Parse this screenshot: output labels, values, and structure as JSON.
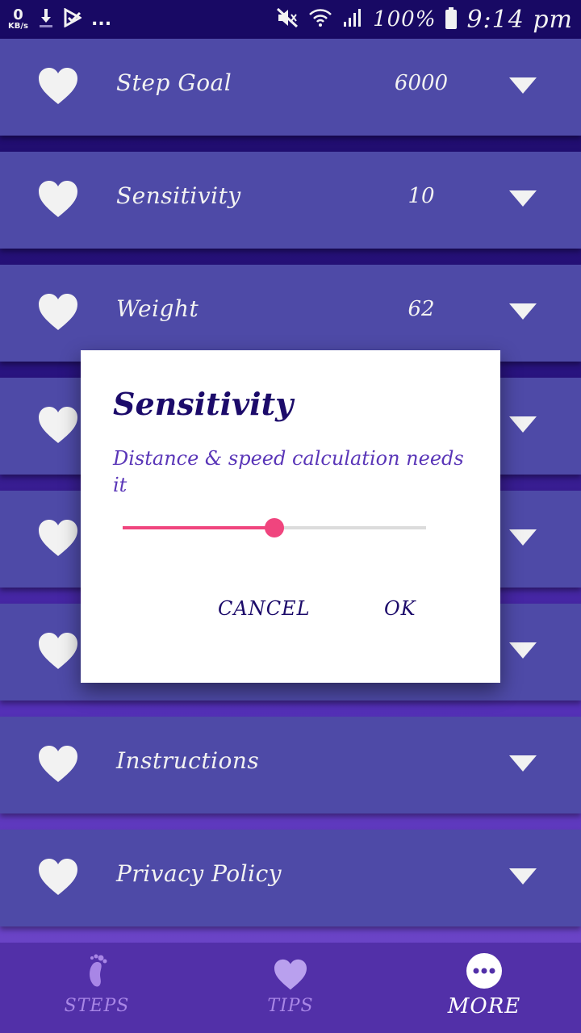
{
  "status_bar": {
    "net_speed_value": "0",
    "net_speed_unit": "KB/s",
    "more": "...",
    "battery_percent": "100%",
    "time": "9:14 pm"
  },
  "settings": {
    "rows": [
      {
        "label": "Step Goal",
        "value": "6000"
      },
      {
        "label": "Sensitivity",
        "value": "10"
      },
      {
        "label": "Weight",
        "value": "62"
      },
      {
        "label": "",
        "value": ""
      },
      {
        "label": "",
        "value": ""
      },
      {
        "label": "",
        "value": ""
      },
      {
        "label": "Instructions",
        "value": ""
      },
      {
        "label": "Privacy Policy",
        "value": ""
      }
    ]
  },
  "dialog": {
    "title": "Sensitivity",
    "message": "Distance & speed calculation needs it",
    "slider_fraction": 0.5,
    "cancel_label": "CANCEL",
    "ok_label": "OK"
  },
  "bottom_nav": {
    "items": [
      {
        "label": "STEPS",
        "icon": "footprint-icon",
        "active": false
      },
      {
        "label": "TIPS",
        "icon": "heart-icon",
        "active": false
      },
      {
        "label": "MORE",
        "icon": "more-dots-icon",
        "active": true
      }
    ]
  },
  "colors": {
    "row_background": "#534eb0",
    "dialog_title": "#1c0b6a",
    "dialog_message": "#5a36b8",
    "slider_accent": "#f0457e",
    "nav_background": "#5230a8",
    "nav_inactive": "#a886e6"
  }
}
